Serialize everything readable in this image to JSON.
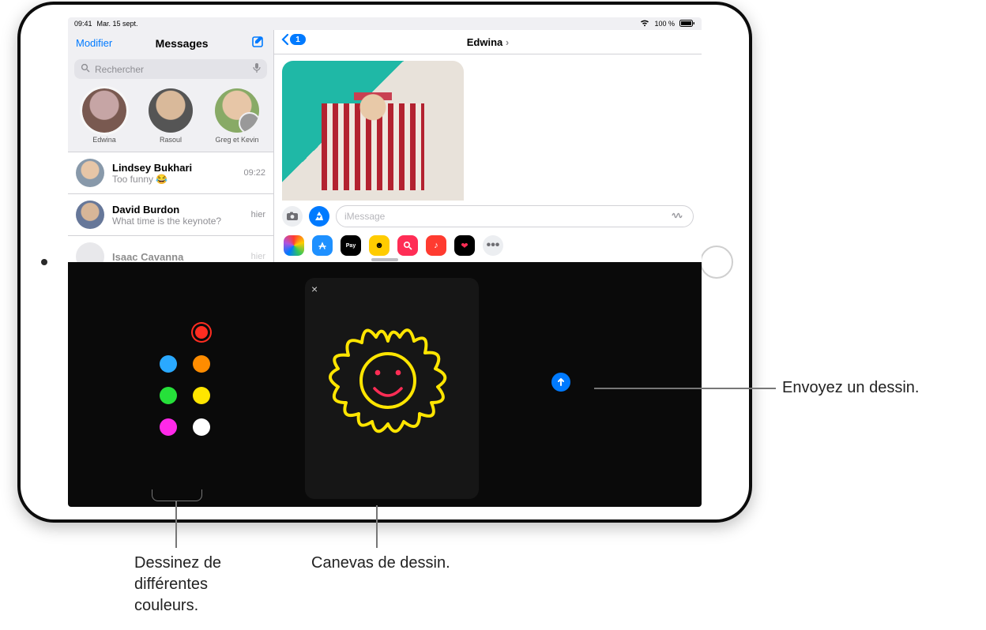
{
  "status": {
    "time": "09:41",
    "date": "Mar. 15 sept.",
    "wifi": "􀙇",
    "battery": "100 %"
  },
  "sidebar": {
    "edit": "Modifier",
    "title": "Messages",
    "search_placeholder": "Rechercher",
    "pins": [
      {
        "name": "Edwina"
      },
      {
        "name": "Rasoul"
      },
      {
        "name": "Greg et Kevin"
      }
    ],
    "rows": [
      {
        "name": "Lindsey Bukhari",
        "preview": "Too funny 😂",
        "time": "09:22"
      },
      {
        "name": "David Burdon",
        "preview": "What time is the keynote?",
        "time": "hier"
      },
      {
        "name": "Isaac Cavanna",
        "preview": "",
        "time": "hier"
      }
    ]
  },
  "convo": {
    "back_badge": "1",
    "title": "Edwina",
    "placeholder": "iMessage"
  },
  "drawer": {
    "apps": [
      {
        "name": "photos-app",
        "bg": "linear-gradient(45deg,#ff2d55,#ffcc00,#34c759,#007aff,#af52de)",
        "label": ""
      },
      {
        "name": "appstore-app",
        "bg": "#1e90ff",
        "label": "A"
      },
      {
        "name": "applepay-app",
        "bg": "#000",
        "label": "Pay"
      },
      {
        "name": "memoji-app",
        "bg": "#ffcc00",
        "label": "☻"
      },
      {
        "name": "search-app",
        "bg": "#ff2d55",
        "label": "@"
      },
      {
        "name": "music-app",
        "bg": "#ff3b30",
        "label": "♪"
      },
      {
        "name": "digitaltouch-app",
        "bg": "#000",
        "label": "❤"
      }
    ],
    "more": "•••"
  },
  "panel": {
    "colors": [
      {
        "hex": "#2aa9ff",
        "sel": false
      },
      {
        "hex": "#ff2d21",
        "sel": true
      },
      {
        "hex": "#2aa9ff",
        "sel": false
      },
      {
        "hex": "#ff8c00",
        "sel": false
      },
      {
        "hex": "#26e03a",
        "sel": false
      },
      {
        "hex": "#ffe500",
        "sel": false
      },
      {
        "hex": "#ff29e9",
        "sel": false
      },
      {
        "hex": "#ffffff",
        "sel": false
      }
    ],
    "close": "×"
  },
  "callouts": {
    "colors": "Dessinez de différentes couleurs.",
    "canvas": "Canevas de dessin.",
    "send": "Envoyez un dessin."
  }
}
